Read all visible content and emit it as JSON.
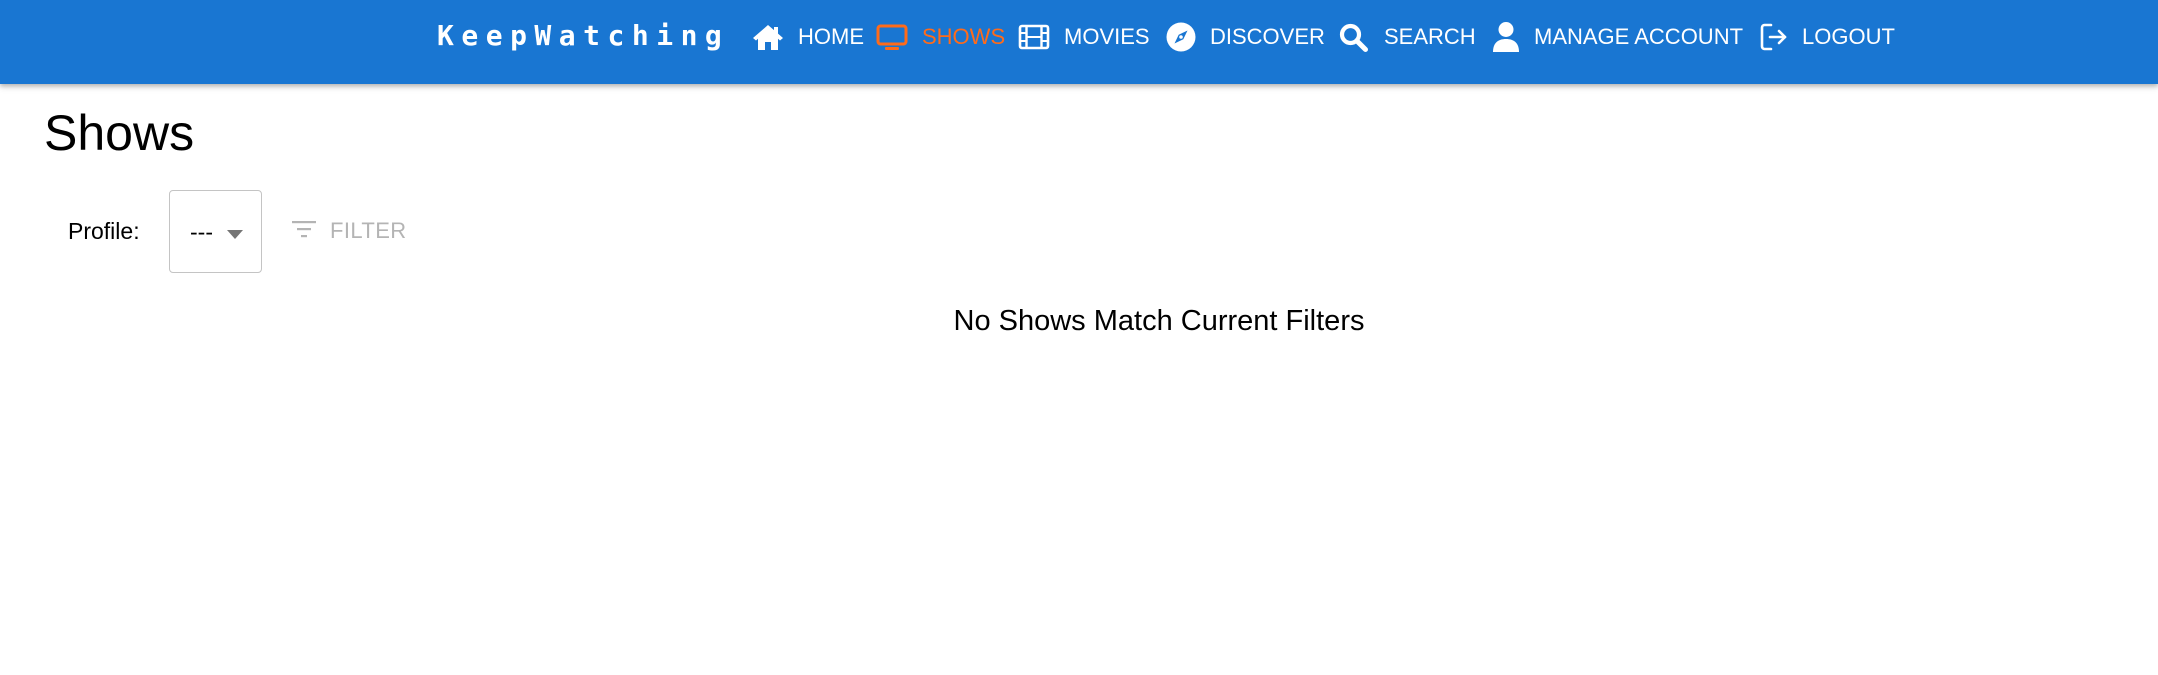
{
  "header": {
    "brand": "KeepWatching",
    "nav": [
      {
        "label": "HOME",
        "icon": "home-icon",
        "active": false
      },
      {
        "label": "SHOWS",
        "icon": "tv-icon",
        "active": true
      },
      {
        "label": "MOVIES",
        "icon": "film-icon",
        "active": false
      },
      {
        "label": "DISCOVER",
        "icon": "compass-icon",
        "active": false
      },
      {
        "label": "SEARCH",
        "icon": "search-icon",
        "active": false
      },
      {
        "label": "MANAGE ACCOUNT",
        "icon": "user-icon",
        "active": false
      },
      {
        "label": "LOGOUT",
        "icon": "logout-icon",
        "active": false
      }
    ]
  },
  "page": {
    "title": "Shows",
    "profile_label": "Profile:",
    "profile_value": "---",
    "filter_label": "FILTER",
    "filter_enabled": false,
    "empty_message": "No Shows Match Current Filters"
  },
  "colors": {
    "appbar": "#1976d2",
    "active_nav": "#ff6b1a",
    "disabled_text": "#b4b4b4"
  }
}
